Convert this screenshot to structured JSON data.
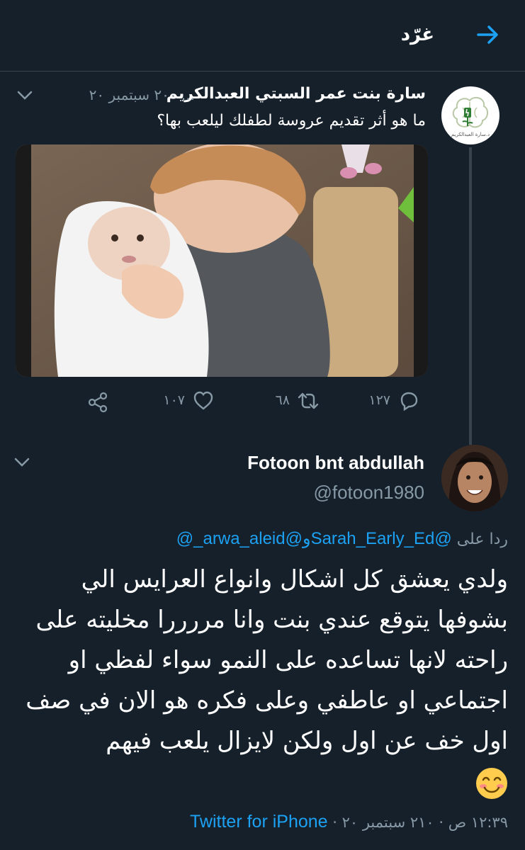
{
  "header": {
    "title": "غرّد"
  },
  "parent_tweet": {
    "author_name": "سارة بنت عمر السبتي العبدالكريم",
    "date": "... ٢٠٠ سبتمبر ٢٠",
    "text": "ما هو أثر تقديم عروسة لطفلك ليلعب بها؟",
    "avatar_caption": "د.سارة العبدالكريم",
    "counts": {
      "replies": "١٢٧",
      "retweets": "٦٨",
      "likes": "١٠٧"
    }
  },
  "reply_tweet": {
    "author_name": "Fotoon bnt abdullah",
    "handle": "@fotoon1980",
    "replying_prefix": "ردا على",
    "mentions": [
      "@Sarah_Early_Ed",
      "@arwa_aleid"
    ],
    "mention_join": "و",
    "mention_tail": "_@",
    "body": "ولدي يعشق كل اشكال وانواع العرايس الي بشوفها يتوقع عندي بنت وانا مررررا مخليته على راحته لانها تساعده على النمو سواء لفظي او اجتماعي او عاطفي وعلى فكره هو الان في صف اول خف عن اول ولكن لايزال يلعب فيهم",
    "time_date": "١٢:٣٩ ص · ٢١٠ سبتمبر ٢٠ ·",
    "source": "Twitter for iPhone"
  },
  "colors": {
    "background": "#15202b",
    "accent": "#1da1f2",
    "muted": "#8899a6",
    "divider": "#38444d"
  }
}
